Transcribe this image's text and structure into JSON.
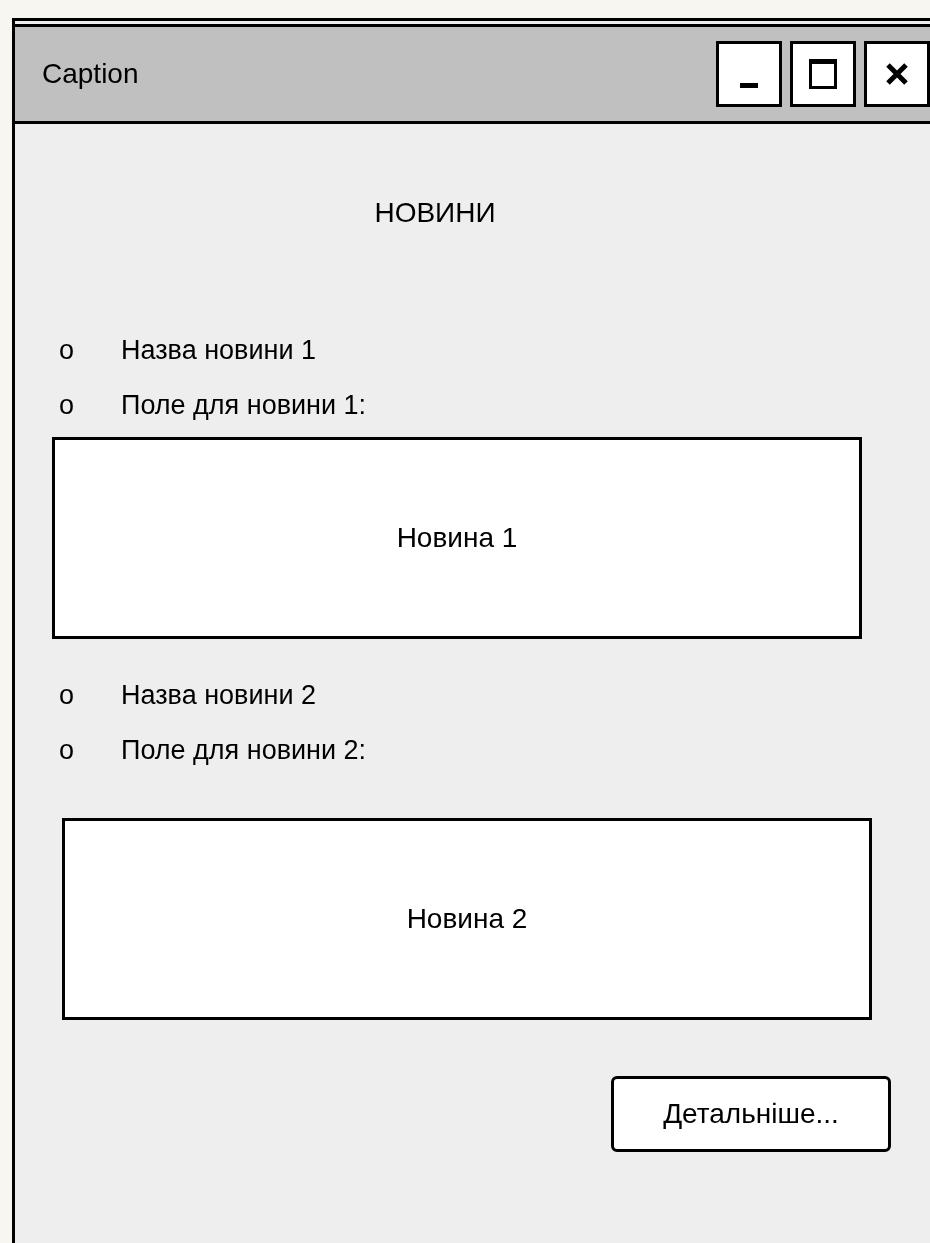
{
  "window": {
    "title": "Caption"
  },
  "heading": "НОВИНИ",
  "news": [
    {
      "name_bullet": "o",
      "name": "Назва новини 1",
      "field_bullet": "o",
      "field_label": "Поле для новини 1:",
      "content": "Новина 1"
    },
    {
      "name_bullet": "o",
      "name": "Назва новини 2",
      "field_bullet": "o",
      "field_label": "Поле для новини 2:",
      "content": "Новина 2"
    }
  ],
  "button": "Детальніше..."
}
